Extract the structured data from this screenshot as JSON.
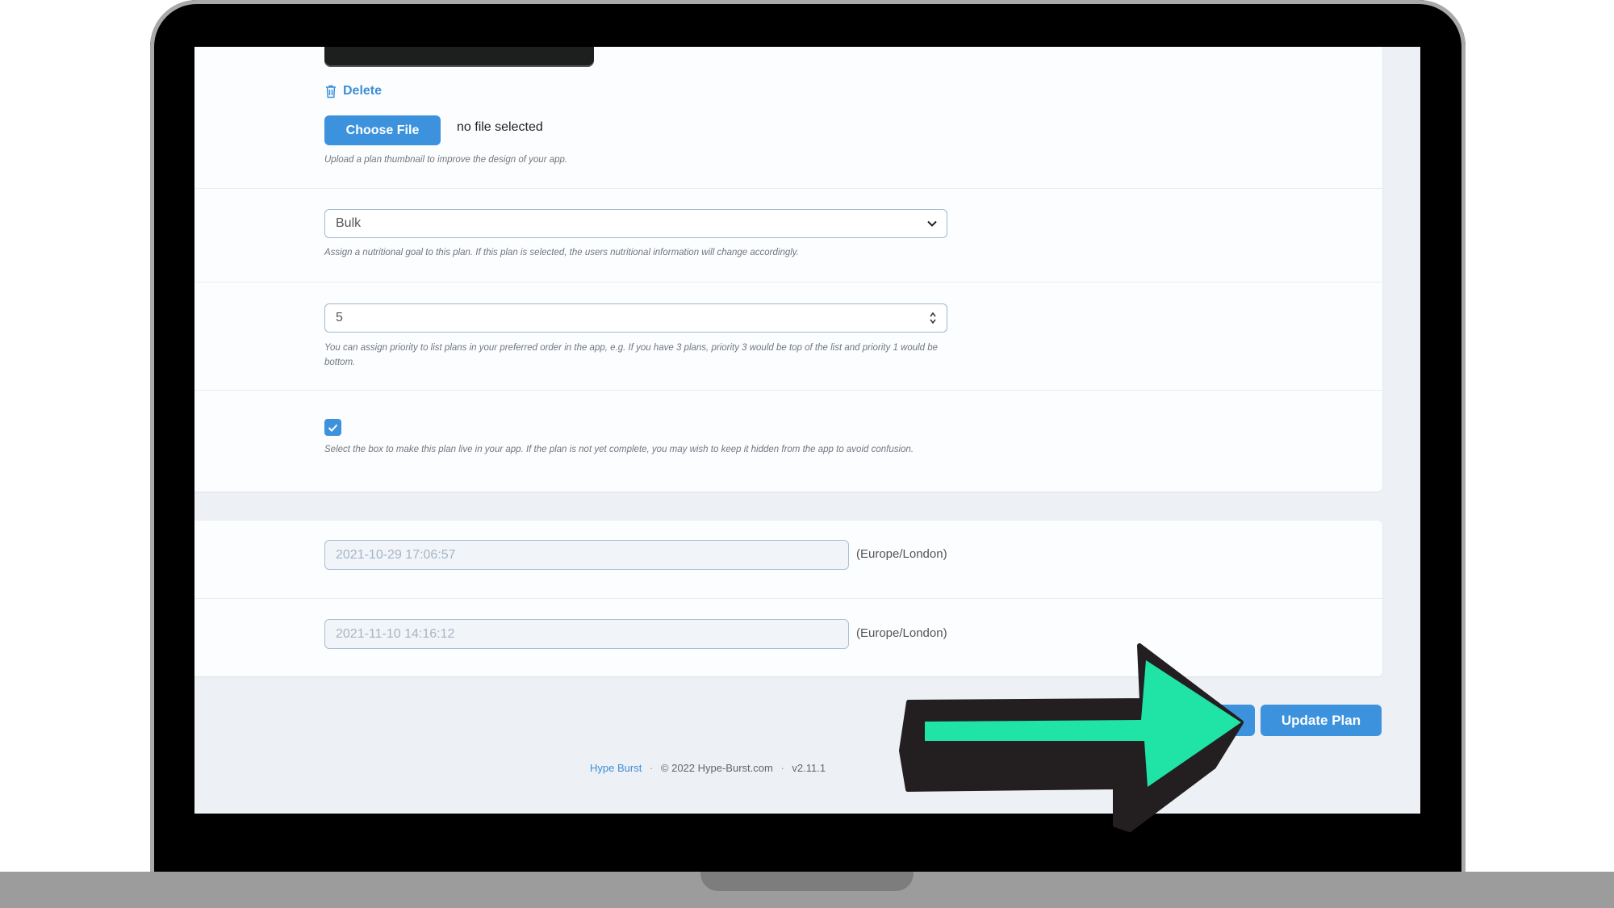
{
  "form": {
    "thumbnail": {
      "delete_label": "Delete",
      "choose_file_label": "Choose File",
      "file_status": "no file selected",
      "help": "Upload a plan thumbnail to improve the design of your app."
    },
    "goal": {
      "selected": "Bulk",
      "help": "Assign a nutritional goal to this plan. If this plan is selected, the users nutritional information will change accordingly."
    },
    "priority": {
      "value": "5",
      "help": "You can assign priority to list plans in your preferred order in the app, e.g. If you have 3 plans, priority 3 would be top of the list and priority 1 would be bottom."
    },
    "live": {
      "checked": true,
      "help": "Select the box to make this plan live in your app. If the plan is not yet complete, you may wish to keep it hidden from the app to avoid confusion."
    }
  },
  "timestamps": {
    "created": {
      "value": "2021-10-29 17:06:57",
      "timezone": "(Europe/London)"
    },
    "updated": {
      "value": "2021-11-10 14:16:12",
      "timezone": "(Europe/London)"
    }
  },
  "actions": {
    "update_label": "Update Plan"
  },
  "footer": {
    "brand": "Hype Burst",
    "copyright": "© 2022 Hype-Burst.com",
    "version": "v2.11.1"
  },
  "colors": {
    "accent": "#3d92dd",
    "arrow_fill": "#20e3a6",
    "arrow_outline": "#231f20"
  },
  "icons": {
    "delete": "trash-icon",
    "select": "chevron-down-icon",
    "checkbox": "check-icon",
    "overlay": "arrow-right-icon"
  }
}
